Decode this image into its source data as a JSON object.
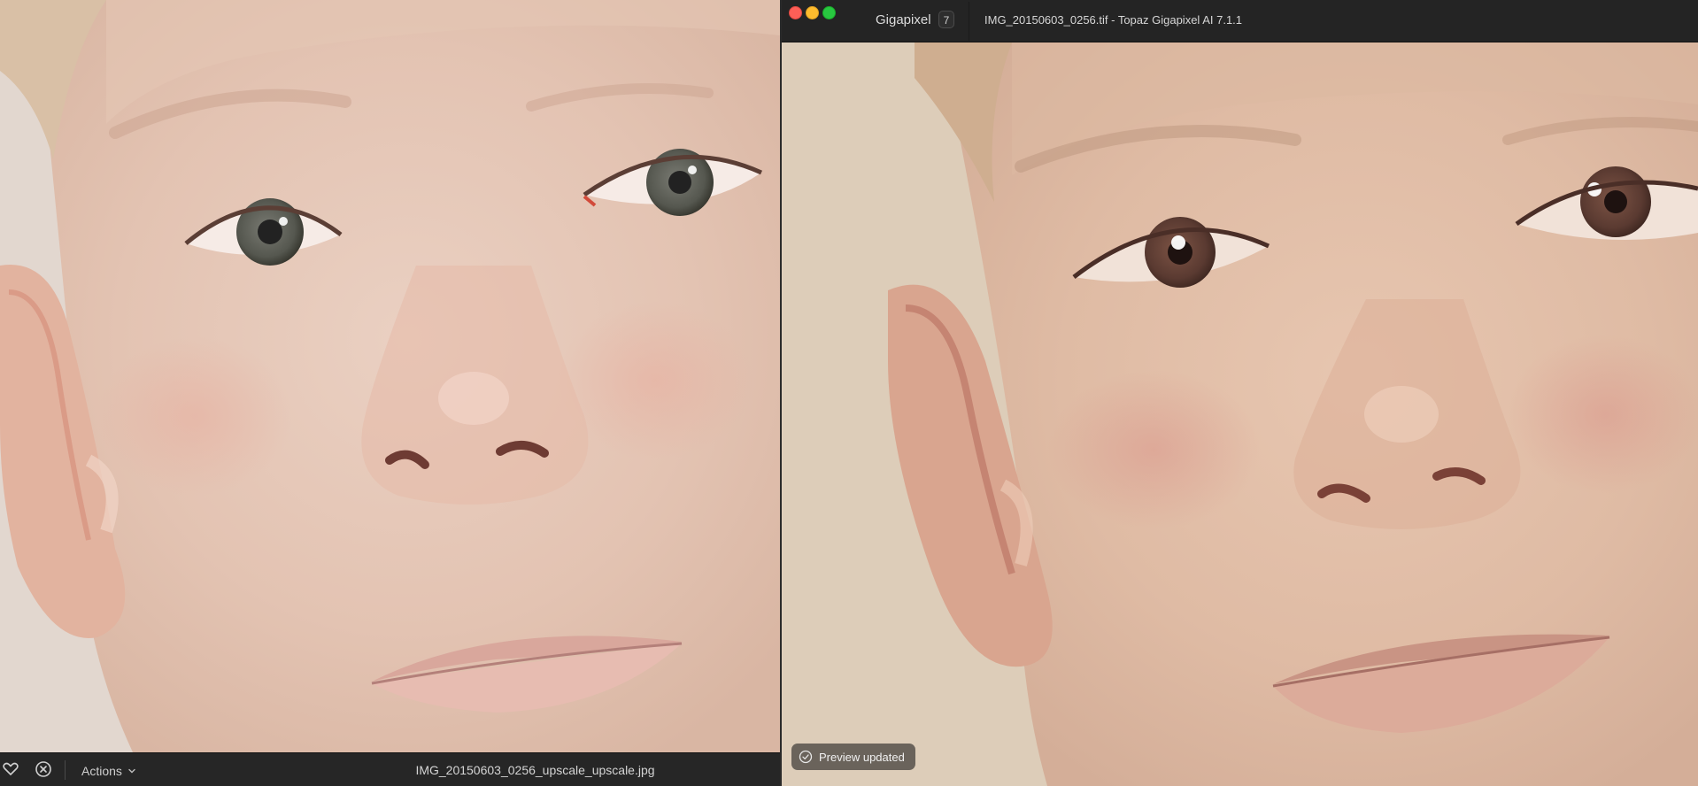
{
  "left_viewer": {
    "photo_alt": "AI-upscaled close-up portrait of a child's face",
    "bottom_bar": {
      "favorite_icon": "heart-icon",
      "reject_icon": "x-circle-icon",
      "actions_label": "Actions",
      "filename": "IMG_20150603_0256_upscale_upscale.jpg"
    }
  },
  "gigapixel_window": {
    "app_name": "Gigapixel",
    "badge_count": "7",
    "title": "IMG_20150603_0256.tif - Topaz Gigapixel AI 7.1.1",
    "toast_message": "Preview updated",
    "photo_alt": "Original close-up portrait of a child's face"
  },
  "colors": {
    "close": "#fe5f57",
    "minimize": "#febc2e",
    "zoom": "#28c840",
    "titlebar": "#242424"
  }
}
